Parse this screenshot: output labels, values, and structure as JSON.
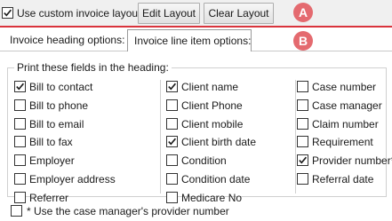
{
  "top": {
    "use_custom_label": "Use custom invoice layout:",
    "use_custom_checked": true,
    "edit_layout_label": "Edit Layout",
    "clear_layout_label": "Clear Layout",
    "badge_a": "A",
    "badge_b": "B"
  },
  "tabs": [
    {
      "label": "Invoice heading options:",
      "active": false
    },
    {
      "label": "Invoice line item options:",
      "active": true
    }
  ],
  "group": {
    "title": "Print these fields in the heading:",
    "columns": [
      [
        {
          "label": "Bill to contact",
          "checked": true
        },
        {
          "label": "Bill to phone",
          "checked": false
        },
        {
          "label": "Bill to email",
          "checked": false
        },
        {
          "label": "Bill to fax",
          "checked": false
        },
        {
          "label": "Employer",
          "checked": false
        },
        {
          "label": "Employer address",
          "checked": false
        },
        {
          "label": "Referrer",
          "checked": false
        }
      ],
      [
        {
          "label": "Client name",
          "checked": true
        },
        {
          "label": "Client Phone",
          "checked": false
        },
        {
          "label": "Client mobile",
          "checked": false
        },
        {
          "label": "Client birth date",
          "checked": true
        },
        {
          "label": "Condition",
          "checked": false
        },
        {
          "label": "Condition date",
          "checked": false
        },
        {
          "label": "Medicare No",
          "checked": false
        }
      ],
      [
        {
          "label": "Case number",
          "checked": false
        },
        {
          "label": "Case manager",
          "checked": false
        },
        {
          "label": "Claim number",
          "checked": false
        },
        {
          "label": "Requirement",
          "checked": false
        },
        {
          "label": "Provider number*",
          "checked": true
        },
        {
          "label": "Referral date",
          "checked": false
        }
      ]
    ]
  },
  "footer": {
    "provider_label": "* Use the case manager's provider number",
    "provider_checked": false
  },
  "colors": {
    "accent_red": "#d9343c",
    "badge_fill": "#e46a6f"
  }
}
